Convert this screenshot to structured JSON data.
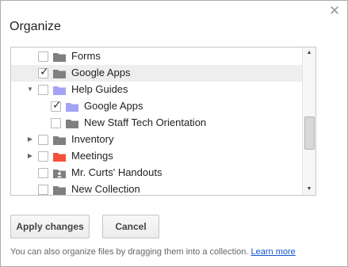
{
  "dialog": {
    "title": "Organize",
    "close_icon": "close-icon"
  },
  "tree": {
    "items": [
      {
        "label": "Forms",
        "checked": false,
        "folder_color": "#7f7f7f",
        "folder_type": "folder-icon",
        "expander": "none",
        "level": 1,
        "selected": false
      },
      {
        "label": "Google Apps",
        "checked": true,
        "folder_color": "#7f7f7f",
        "folder_type": "folder-icon",
        "expander": "none",
        "level": 1,
        "selected": true
      },
      {
        "label": "Help Guides",
        "checked": false,
        "folder_color": "#a3a3f5",
        "folder_type": "folder-icon",
        "expander": "expanded",
        "level": 1,
        "selected": false
      },
      {
        "label": "Google Apps",
        "checked": true,
        "folder_color": "#a3a3f5",
        "folder_type": "folder-icon",
        "expander": "none",
        "level": 2,
        "selected": false
      },
      {
        "label": "New Staff Tech Orientation",
        "checked": false,
        "folder_color": "#7f7f7f",
        "folder_type": "folder-icon",
        "expander": "none",
        "level": 2,
        "selected": false
      },
      {
        "label": "Inventory",
        "checked": false,
        "folder_color": "#7f7f7f",
        "folder_type": "folder-icon",
        "expander": "collapsed",
        "level": 1,
        "selected": false
      },
      {
        "label": "Meetings",
        "checked": false,
        "folder_color": "#f4513a",
        "folder_type": "folder-icon",
        "expander": "collapsed",
        "level": 1,
        "selected": false
      },
      {
        "label": "Mr. Curts' Handouts",
        "checked": false,
        "folder_color": "#7f7f7f",
        "folder_type": "shared-folder-icon",
        "expander": "none",
        "level": 1,
        "selected": false
      },
      {
        "label": "New Collection",
        "checked": false,
        "folder_color": "#7f7f7f",
        "folder_type": "folder-icon",
        "expander": "none",
        "level": 1,
        "selected": false
      }
    ]
  },
  "buttons": {
    "apply": "Apply changes",
    "cancel": "Cancel"
  },
  "footer": {
    "text": "You can also organize files by dragging them into a collection.",
    "link": "Learn more"
  }
}
